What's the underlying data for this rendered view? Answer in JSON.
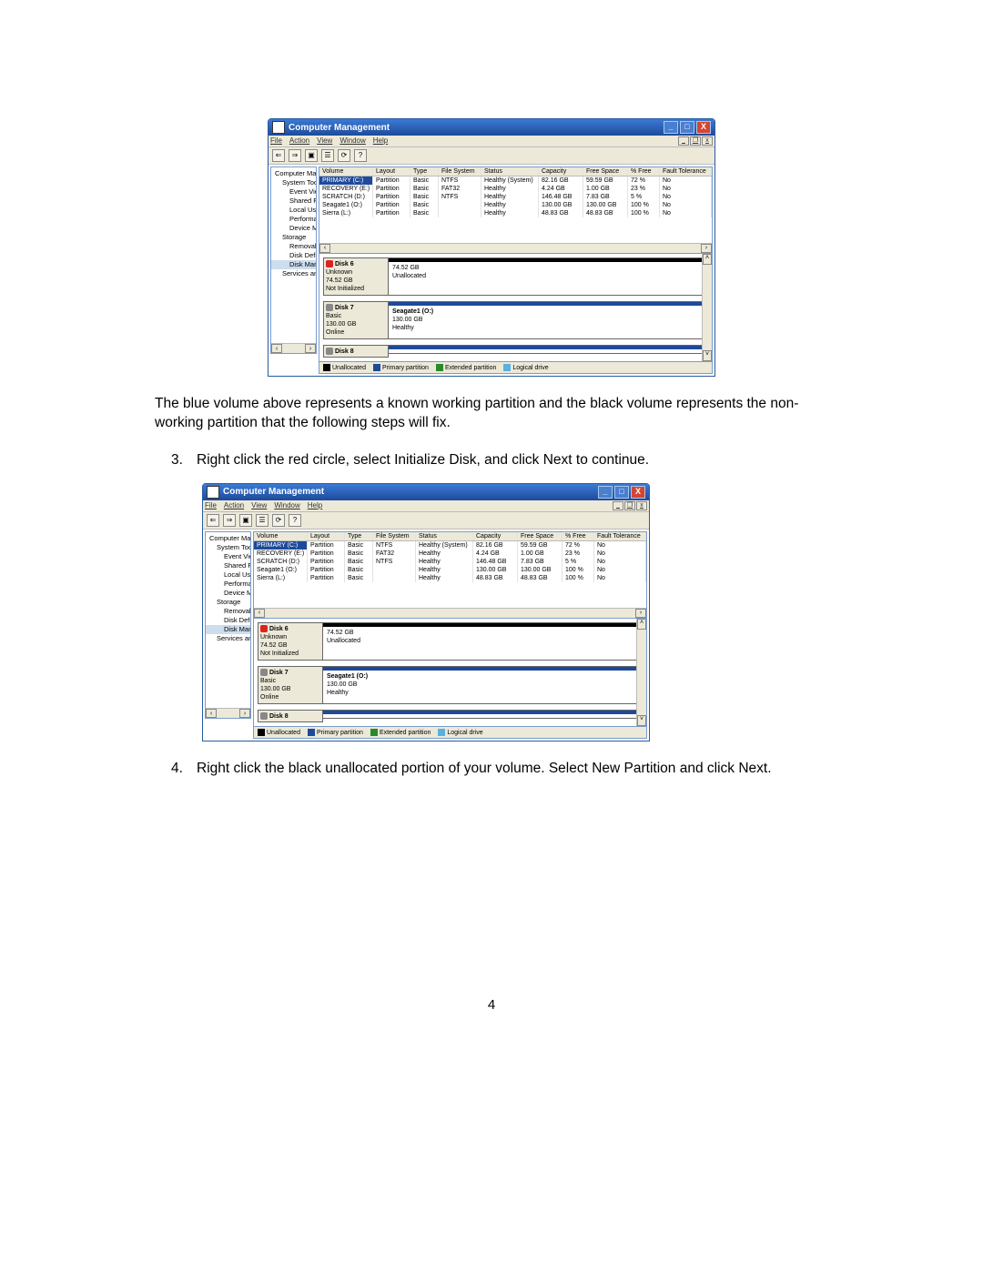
{
  "para1": "The blue volume above represents a known working partition and the black volume represents the non-working partition that the following steps will fix.",
  "step3_num": "3.",
  "step3_text": "Right click the red circle, select Initialize Disk, and click Next to continue.",
  "step4_num": "4.",
  "step4_text": "Right click the black unallocated portion of your volume. Select New Partition and click Next.",
  "page_number": "4",
  "window": {
    "title": "Computer Management",
    "menu": [
      "File",
      "Action",
      "View",
      "Window",
      "Help"
    ],
    "tree_root": "Computer Management (Local)",
    "tree": [
      "System Tools",
      "Event Viewer",
      "Shared Folders",
      "Local Users and Groups",
      "Performance Logs and Alerts",
      "Device Manager",
      "Storage",
      "Removable Storage",
      "Disk Defragmenter",
      "Disk Management",
      "Services and Applications"
    ],
    "columns": [
      "Volume",
      "Layout",
      "Type",
      "File System",
      "Status",
      "Capacity",
      "Free Space",
      "% Free",
      "Fault Tolerance"
    ],
    "volumes": [
      {
        "vol": "PRIMARY (C:)",
        "lay": "Partition",
        "typ": "Basic",
        "fs": "NTFS",
        "st": "Healthy (System)",
        "cap": "82.16 GB",
        "fr": "59.59 GB",
        "pf": "72 %",
        "ft": "No",
        "selected": true
      },
      {
        "vol": "RECOVERY (E:)",
        "lay": "Partition",
        "typ": "Basic",
        "fs": "FAT32",
        "st": "Healthy",
        "cap": "4.24 GB",
        "fr": "1.00 GB",
        "pf": "23 %",
        "ft": "No"
      },
      {
        "vol": "SCRATCH (D:)",
        "lay": "Partition",
        "typ": "Basic",
        "fs": "NTFS",
        "st": "Healthy",
        "cap": "146.48 GB",
        "fr": "7.83 GB",
        "pf": "5 %",
        "ft": "No"
      },
      {
        "vol": "Seagate1 (O:)",
        "lay": "Partition",
        "typ": "Basic",
        "fs": "",
        "st": "Healthy",
        "cap": "130.00 GB",
        "fr": "130.00 GB",
        "pf": "100 %",
        "ft": "No"
      },
      {
        "vol": "Sierra (L:)",
        "lay": "Partition",
        "typ": "Basic",
        "fs": "",
        "st": "Healthy",
        "cap": "48.83 GB",
        "fr": "48.83 GB",
        "pf": "100 %",
        "ft": "No"
      }
    ],
    "disk6": {
      "name": "Disk 6",
      "kind": "Unknown",
      "size": "74.52 GB",
      "state": "Not Initialized",
      "bar_size": "74.52 GB",
      "bar_state": "Unallocated"
    },
    "disk7": {
      "name": "Disk 7",
      "kind": "Basic",
      "size": "130.00 GB",
      "state": "Online",
      "bar_title": "Seagate1 (O:)",
      "bar_size": "130.00 GB",
      "bar_state": "Healthy"
    },
    "disk8": {
      "name": "Disk 8"
    },
    "legend": [
      "Unallocated",
      "Primary partition",
      "Extended partition",
      "Logical drive"
    ]
  }
}
